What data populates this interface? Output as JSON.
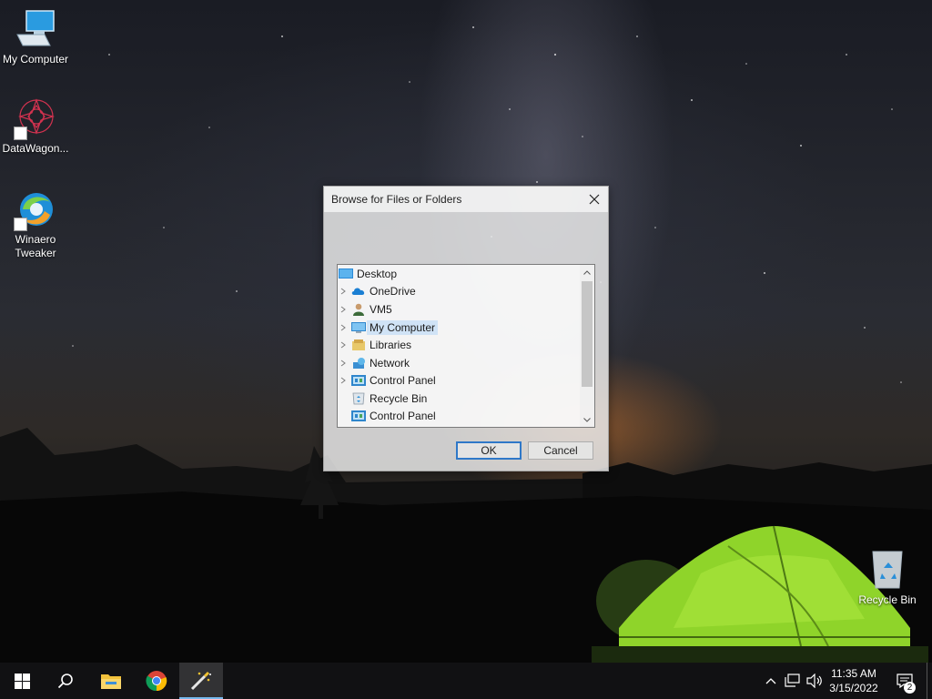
{
  "desktop": {
    "icons": [
      {
        "label": "My Computer",
        "icon": "computer-icon"
      },
      {
        "label": "DataWagon...",
        "icon": "datawagon-icon"
      },
      {
        "label": "Winaero Tweaker",
        "icon": "winaero-tweaker-icon"
      },
      {
        "label": "Recycle Bin",
        "icon": "recycle-bin-icon"
      }
    ]
  },
  "dialog": {
    "title": "Browse for Files or Folders",
    "tree": [
      {
        "label": "Desktop",
        "icon": "desktop-folder-icon",
        "expander": false,
        "selected": false
      },
      {
        "label": "OneDrive",
        "icon": "onedrive-cloud-icon",
        "expander": true,
        "selected": false
      },
      {
        "label": "VM5",
        "icon": "user-icon",
        "expander": true,
        "selected": false
      },
      {
        "label": "My Computer",
        "icon": "computer-icon",
        "expander": true,
        "selected": true
      },
      {
        "label": "Libraries",
        "icon": "libraries-icon",
        "expander": true,
        "selected": false
      },
      {
        "label": "Network",
        "icon": "network-icon",
        "expander": true,
        "selected": false
      },
      {
        "label": "Control Panel",
        "icon": "control-panel-icon",
        "expander": true,
        "selected": false
      },
      {
        "label": "Recycle Bin",
        "icon": "recycle-bin-icon",
        "expander": false,
        "selected": false
      },
      {
        "label": "Control Panel",
        "icon": "control-panel-icon",
        "expander": false,
        "selected": false
      }
    ],
    "ok_label": "OK",
    "cancel_label": "Cancel"
  },
  "taskbar": {
    "apps": [
      "start-icon",
      "search-icon",
      "file-explorer-icon",
      "chrome-icon",
      "winaero-tweaker-icon"
    ],
    "active_app": "winaero-tweaker-icon",
    "clock": {
      "time": "11:35 AM",
      "date": "3/15/2022"
    },
    "notifications_count": "2"
  },
  "colors": {
    "accent": "#76b9ed",
    "default_button_border": "#2f78c8",
    "selection": "#cde1f5",
    "tent_green": "#8fd42a"
  }
}
